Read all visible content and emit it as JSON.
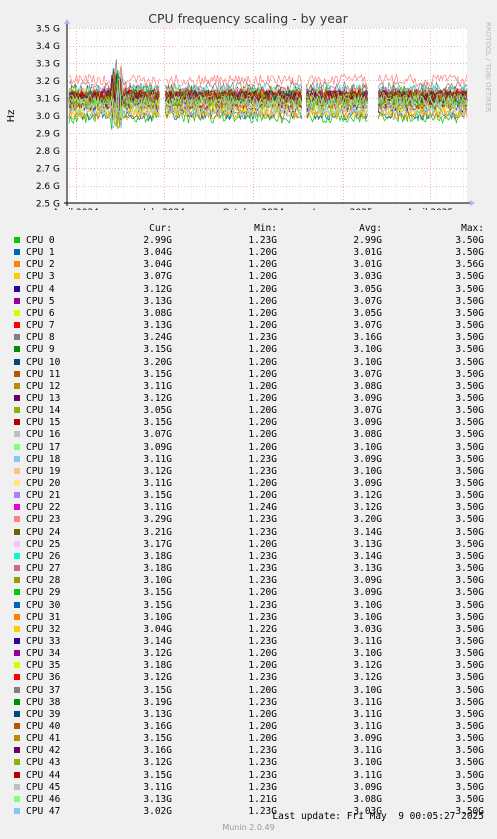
{
  "chart_data": {
    "type": "line",
    "title": "CPU frequency scaling - by year",
    "ylabel": "Hz",
    "ylim": [
      2.5,
      3.5
    ],
    "yunit": "G",
    "yticks": [
      2.5,
      2.6,
      2.7,
      2.8,
      2.9,
      3.0,
      3.1,
      3.2,
      3.3,
      3.4,
      3.5
    ],
    "ytick_labels": [
      "2.5 G",
      "2.6 G",
      "2.7 G",
      "2.8 G",
      "2.9 G",
      "3.0 G",
      "3.1 G",
      "3.2 G",
      "3.3 G",
      "3.4 G",
      "3.5 G"
    ],
    "xlim": [
      "2024-03-23",
      "2025-05-09"
    ],
    "xticks": [
      {
        "date": "2024-04-01",
        "label": "April 2024"
      },
      {
        "date": "2024-07-01",
        "label": "July 2024"
      },
      {
        "date": "2024-10-01",
        "label": "October 2024"
      },
      {
        "date": "2025-01-01",
        "label": "January 2025"
      },
      {
        "date": "2025-04-01",
        "label": "April 2025"
      }
    ],
    "grid": true,
    "watermark": "RRDTOOL / TOBI OETIKER",
    "columns": [
      "Cur:",
      "Min:",
      "Avg:",
      "Max:"
    ],
    "series": [
      {
        "name": "CPU 0",
        "color": "#00cc00",
        "cur": "2.99G",
        "min": "1.23G",
        "avg": "2.99G",
        "max": "3.50G"
      },
      {
        "name": "CPU 1",
        "color": "#0066b3",
        "cur": "3.04G",
        "min": "1.20G",
        "avg": "3.01G",
        "max": "3.50G"
      },
      {
        "name": "CPU 2",
        "color": "#ff8000",
        "cur": "3.04G",
        "min": "1.20G",
        "avg": "3.01G",
        "max": "3.56G"
      },
      {
        "name": "CPU 3",
        "color": "#ffcc00",
        "cur": "3.07G",
        "min": "1.20G",
        "avg": "3.03G",
        "max": "3.50G"
      },
      {
        "name": "CPU 4",
        "color": "#330099",
        "cur": "3.12G",
        "min": "1.20G",
        "avg": "3.05G",
        "max": "3.50G"
      },
      {
        "name": "CPU 5",
        "color": "#990099",
        "cur": "3.13G",
        "min": "1.20G",
        "avg": "3.07G",
        "max": "3.50G"
      },
      {
        "name": "CPU 6",
        "color": "#ccff00",
        "cur": "3.08G",
        "min": "1.20G",
        "avg": "3.05G",
        "max": "3.50G"
      },
      {
        "name": "CPU 7",
        "color": "#ff0000",
        "cur": "3.13G",
        "min": "1.20G",
        "avg": "3.07G",
        "max": "3.50G"
      },
      {
        "name": "CPU 8",
        "color": "#808080",
        "cur": "3.24G",
        "min": "1.23G",
        "avg": "3.16G",
        "max": "3.50G"
      },
      {
        "name": "CPU 9",
        "color": "#008f00",
        "cur": "3.15G",
        "min": "1.20G",
        "avg": "3.10G",
        "max": "3.50G"
      },
      {
        "name": "CPU 10",
        "color": "#00487d",
        "cur": "3.20G",
        "min": "1.20G",
        "avg": "3.10G",
        "max": "3.50G"
      },
      {
        "name": "CPU 11",
        "color": "#b35a00",
        "cur": "3.15G",
        "min": "1.20G",
        "avg": "3.07G",
        "max": "3.50G"
      },
      {
        "name": "CPU 12",
        "color": "#b38f00",
        "cur": "3.11G",
        "min": "1.20G",
        "avg": "3.08G",
        "max": "3.50G"
      },
      {
        "name": "CPU 13",
        "color": "#6b006b",
        "cur": "3.12G",
        "min": "1.20G",
        "avg": "3.09G",
        "max": "3.50G"
      },
      {
        "name": "CPU 14",
        "color": "#8fb300",
        "cur": "3.05G",
        "min": "1.20G",
        "avg": "3.07G",
        "max": "3.50G"
      },
      {
        "name": "CPU 15",
        "color": "#b30000",
        "cur": "3.15G",
        "min": "1.20G",
        "avg": "3.09G",
        "max": "3.50G"
      },
      {
        "name": "CPU 16",
        "color": "#bebebe",
        "cur": "3.07G",
        "min": "1.20G",
        "avg": "3.08G",
        "max": "3.50G"
      },
      {
        "name": "CPU 17",
        "color": "#80ff80",
        "cur": "3.09G",
        "min": "1.20G",
        "avg": "3.10G",
        "max": "3.50G"
      },
      {
        "name": "CPU 18",
        "color": "#80c9ff",
        "cur": "3.11G",
        "min": "1.23G",
        "avg": "3.09G",
        "max": "3.50G"
      },
      {
        "name": "CPU 19",
        "color": "#ffc080",
        "cur": "3.12G",
        "min": "1.23G",
        "avg": "3.10G",
        "max": "3.50G"
      },
      {
        "name": "CPU 20",
        "color": "#ffe680",
        "cur": "3.11G",
        "min": "1.20G",
        "avg": "3.09G",
        "max": "3.50G"
      },
      {
        "name": "CPU 21",
        "color": "#aa80ff",
        "cur": "3.15G",
        "min": "1.20G",
        "avg": "3.12G",
        "max": "3.50G"
      },
      {
        "name": "CPU 22",
        "color": "#ee00cc",
        "cur": "3.11G",
        "min": "1.24G",
        "avg": "3.12G",
        "max": "3.50G"
      },
      {
        "name": "CPU 23",
        "color": "#ff8080",
        "cur": "3.29G",
        "min": "1.23G",
        "avg": "3.20G",
        "max": "3.50G"
      },
      {
        "name": "CPU 24",
        "color": "#666600",
        "cur": "3.21G",
        "min": "1.23G",
        "avg": "3.14G",
        "max": "3.50G"
      },
      {
        "name": "CPU 25",
        "color": "#ffbfff",
        "cur": "3.17G",
        "min": "1.20G",
        "avg": "3.13G",
        "max": "3.50G"
      },
      {
        "name": "CPU 26",
        "color": "#00ffcc",
        "cur": "3.18G",
        "min": "1.23G",
        "avg": "3.14G",
        "max": "3.50G"
      },
      {
        "name": "CPU 27",
        "color": "#cc6699",
        "cur": "3.18G",
        "min": "1.23G",
        "avg": "3.13G",
        "max": "3.50G"
      },
      {
        "name": "CPU 28",
        "color": "#999900",
        "cur": "3.10G",
        "min": "1.23G",
        "avg": "3.09G",
        "max": "3.50G"
      },
      {
        "name": "CPU 29",
        "color": "#00cc00",
        "cur": "3.15G",
        "min": "1.20G",
        "avg": "3.09G",
        "max": "3.50G"
      },
      {
        "name": "CPU 30",
        "color": "#0066b3",
        "cur": "3.15G",
        "min": "1.23G",
        "avg": "3.10G",
        "max": "3.50G"
      },
      {
        "name": "CPU 31",
        "color": "#ff8000",
        "cur": "3.10G",
        "min": "1.23G",
        "avg": "3.10G",
        "max": "3.50G"
      },
      {
        "name": "CPU 32",
        "color": "#ffcc00",
        "cur": "3.04G",
        "min": "1.22G",
        "avg": "3.03G",
        "max": "3.50G"
      },
      {
        "name": "CPU 33",
        "color": "#330099",
        "cur": "3.14G",
        "min": "1.23G",
        "avg": "3.11G",
        "max": "3.50G"
      },
      {
        "name": "CPU 34",
        "color": "#990099",
        "cur": "3.12G",
        "min": "1.20G",
        "avg": "3.10G",
        "max": "3.50G"
      },
      {
        "name": "CPU 35",
        "color": "#ccff00",
        "cur": "3.18G",
        "min": "1.20G",
        "avg": "3.12G",
        "max": "3.50G"
      },
      {
        "name": "CPU 36",
        "color": "#ff0000",
        "cur": "3.12G",
        "min": "1.23G",
        "avg": "3.12G",
        "max": "3.50G"
      },
      {
        "name": "CPU 37",
        "color": "#808080",
        "cur": "3.15G",
        "min": "1.20G",
        "avg": "3.10G",
        "max": "3.50G"
      },
      {
        "name": "CPU 38",
        "color": "#008f00",
        "cur": "3.19G",
        "min": "1.23G",
        "avg": "3.11G",
        "max": "3.50G"
      },
      {
        "name": "CPU 39",
        "color": "#00487d",
        "cur": "3.13G",
        "min": "1.20G",
        "avg": "3.11G",
        "max": "3.50G"
      },
      {
        "name": "CPU 40",
        "color": "#b35a00",
        "cur": "3.16G",
        "min": "1.20G",
        "avg": "3.11G",
        "max": "3.50G"
      },
      {
        "name": "CPU 41",
        "color": "#b38f00",
        "cur": "3.15G",
        "min": "1.20G",
        "avg": "3.09G",
        "max": "3.50G"
      },
      {
        "name": "CPU 42",
        "color": "#6b006b",
        "cur": "3.16G",
        "min": "1.23G",
        "avg": "3.11G",
        "max": "3.50G"
      },
      {
        "name": "CPU 43",
        "color": "#8fb300",
        "cur": "3.12G",
        "min": "1.23G",
        "avg": "3.10G",
        "max": "3.50G"
      },
      {
        "name": "CPU 44",
        "color": "#b30000",
        "cur": "3.15G",
        "min": "1.23G",
        "avg": "3.11G",
        "max": "3.50G"
      },
      {
        "name": "CPU 45",
        "color": "#bebebe",
        "cur": "3.11G",
        "min": "1.23G",
        "avg": "3.09G",
        "max": "3.50G"
      },
      {
        "name": "CPU 46",
        "color": "#80ff80",
        "cur": "3.13G",
        "min": "1.21G",
        "avg": "3.08G",
        "max": "3.50G"
      },
      {
        "name": "CPU 47",
        "color": "#80c9ff",
        "cur": "3.02G",
        "min": "1.23G",
        "avg": "3.03G",
        "max": "3.50G"
      }
    ]
  },
  "footer": {
    "last_update": "Last update: Fri May  9 00:05:27 2025",
    "credit": "Munin 2.0.49"
  }
}
